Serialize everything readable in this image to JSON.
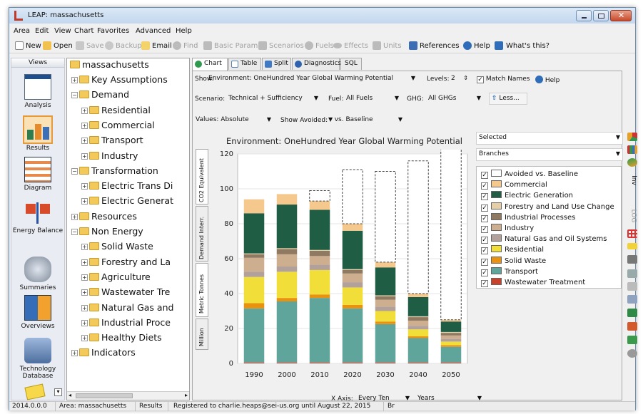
{
  "window": {
    "title": "LEAP: massachusetts"
  },
  "menu": [
    "Area",
    "Edit",
    "View",
    "Chart",
    "Favorites",
    "Advanced",
    "Help"
  ],
  "toolbar": {
    "new": "New",
    "open": "Open",
    "save": "Save",
    "backup": "Backup",
    "email": "Email",
    "find": "Find",
    "basic_params": "Basic Params",
    "scenarios": "Scenarios",
    "fuels": "Fuels",
    "effects": "Effects",
    "units": "Units",
    "references": "References",
    "help": "Help",
    "whats_this": "What's this?"
  },
  "views": {
    "header": "Views",
    "items": [
      {
        "label": "Analysis",
        "icon": "analysis-icon"
      },
      {
        "label": "Results",
        "icon": "results-icon"
      },
      {
        "label": "Diagram",
        "icon": "diagram-icon"
      },
      {
        "label": "Energy Balance",
        "icon": "energy-balance-icon"
      },
      {
        "label": "Summaries",
        "icon": "summaries-icon"
      },
      {
        "label": "Overviews",
        "icon": "overviews-icon"
      },
      {
        "label": "Technology Database",
        "icon": "technology-database-icon"
      }
    ]
  },
  "tree": {
    "root": "massachusetts",
    "nodes": [
      {
        "label": "Key Assumptions",
        "level": 1,
        "sign": "+"
      },
      {
        "label": "Demand",
        "level": 1,
        "sign": "−"
      },
      {
        "label": "Residential",
        "level": 2,
        "sign": "+"
      },
      {
        "label": "Commercial",
        "level": 2,
        "sign": "+"
      },
      {
        "label": "Transport",
        "level": 2,
        "sign": "+"
      },
      {
        "label": "Industry",
        "level": 2,
        "sign": "+"
      },
      {
        "label": "Transformation",
        "level": 1,
        "sign": "−"
      },
      {
        "label": "Electric Trans Di",
        "level": 2,
        "sign": "+"
      },
      {
        "label": "Electric Generat",
        "level": 2,
        "sign": "+"
      },
      {
        "label": "Resources",
        "level": 1,
        "sign": "+"
      },
      {
        "label": "Non Energy",
        "level": 1,
        "sign": "−"
      },
      {
        "label": "Solid Waste",
        "level": 2,
        "sign": "+"
      },
      {
        "label": "Forestry and La",
        "level": 2,
        "sign": "+"
      },
      {
        "label": "Agriculture",
        "level": 2,
        "sign": "+"
      },
      {
        "label": "Wastewater Tre",
        "level": 2,
        "sign": "+"
      },
      {
        "label": "Natural Gas and",
        "level": 2,
        "sign": "+"
      },
      {
        "label": "Industrial Proce",
        "level": 2,
        "sign": "+"
      },
      {
        "label": "Healthy Diets",
        "level": 2,
        "sign": "+"
      },
      {
        "label": "Indicators",
        "level": 1,
        "sign": "+"
      }
    ]
  },
  "tabs": [
    "Chart",
    "Table",
    "Split",
    "Diagnostics",
    "SQL"
  ],
  "controls": {
    "show_label": "Show:",
    "show_value": "Environment: OneHundred Year Global Warming Potential",
    "levels_label": "Levels:",
    "levels_value": "2",
    "match_names": "Match Names",
    "help": "Help",
    "scenario_label": "Scenario:",
    "scenario_value": "Technical + Sufficiency",
    "fuel_label": "Fuel:",
    "fuel_value": "All Fuels",
    "ghg_label": "GHG:",
    "ghg_value": "All GHGs",
    "less": "Less...",
    "values_value": "Values: Absolute",
    "show_avoided": "Show Avoided:",
    "vs_baseline": "vs. Baseline",
    "selected": "Selected",
    "branches": "Branches",
    "xaxis_label": "X Axis:",
    "xaxis_value": "Every Ten",
    "years": "Years"
  },
  "vertical_tabs": [
    "CO2 Equivalent",
    "Demand Interr.",
    "Metric Tonnes",
    "Million"
  ],
  "right_tool_labels": {
    "inv": "Inv",
    "log": "LOG"
  },
  "chart_data": {
    "type": "bar",
    "title": "Environment: OneHundred Year Global Warming Potential",
    "ylabel": "",
    "categories": [
      "1990",
      "2000",
      "2010",
      "2020",
      "2030",
      "2040",
      "2050"
    ],
    "ylim": [
      0,
      120
    ],
    "yticks": [
      0,
      20,
      40,
      60,
      80,
      100,
      120
    ],
    "series": [
      {
        "name": "Wastewater Treatment",
        "color": "#c8412b",
        "values": [
          0.5,
          0.5,
          0.5,
          0.5,
          0.5,
          0.5,
          0.5
        ]
      },
      {
        "name": "Transport",
        "color": "#5fa59b",
        "values": [
          31,
          35,
          37,
          31,
          22,
          14,
          9
        ]
      },
      {
        "name": "Solid Waste",
        "color": "#e8920f",
        "values": [
          3,
          2,
          2,
          2,
          1.5,
          1,
          1
        ]
      },
      {
        "name": "Residential",
        "color": "#f2de38",
        "values": [
          15,
          15,
          14,
          10,
          6,
          4,
          2
        ]
      },
      {
        "name": "Natural Gas and Oil Systems",
        "color": "#b2a19a",
        "values": [
          3,
          3,
          3,
          3,
          2.5,
          2,
          1.5
        ]
      },
      {
        "name": "Industry",
        "color": "#cdae8f",
        "values": [
          8,
          7,
          5,
          5,
          4,
          3,
          2
        ]
      },
      {
        "name": "Industrial Processes",
        "color": "#8f7a61",
        "values": [
          2,
          3,
          3,
          2,
          2,
          2,
          1.5
        ]
      },
      {
        "name": "Forestry and Land Use Change",
        "color": "#e6cfa6",
        "values": [
          0.5,
          0.5,
          0.5,
          0.5,
          0.5,
          0.5,
          0.5
        ]
      },
      {
        "name": "Electric Generation",
        "color": "#1f5e45",
        "values": [
          23,
          25,
          23,
          22,
          16,
          11,
          6
        ]
      },
      {
        "name": "Commercial",
        "color": "#f5c98e",
        "values": [
          8,
          6,
          5,
          4,
          3,
          2,
          1
        ]
      },
      {
        "name": "Avoided vs. Baseline",
        "color": "#ffffff",
        "values": [
          0,
          0,
          6,
          31,
          52,
          76,
          98
        ]
      }
    ]
  },
  "legend": [
    "Avoided vs. Baseline",
    "Commercial",
    "Electric Generation",
    "Forestry and Land Use Change",
    "Industrial Processes",
    "Industry",
    "Natural Gas and Oil Systems",
    "Residential",
    "Solid Waste",
    "Transport",
    "Wastewater Treatment"
  ],
  "legend_colors": [
    "#ffffff",
    "#f5c98e",
    "#1f5e45",
    "#e6cfa6",
    "#8f7a61",
    "#cdae8f",
    "#b2a19a",
    "#f2de38",
    "#e8920f",
    "#5fa59b",
    "#c8412b"
  ],
  "status": {
    "version": "2014.0.0.0",
    "area": "Area: massachusetts",
    "view": "Results",
    "registration": "Registered to charlie.heaps@sei-us.org until August 22, 2015",
    "extra": "Br"
  }
}
